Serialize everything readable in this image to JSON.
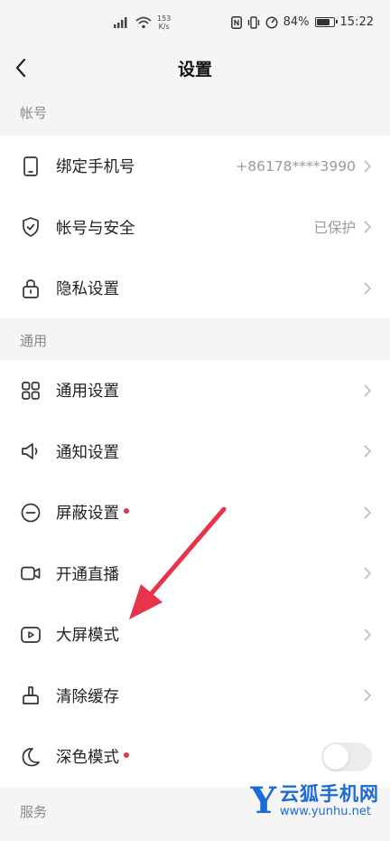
{
  "status_bar": {
    "net_speed_value": "153",
    "net_speed_unit": "K/s",
    "battery_percent": "84%",
    "battery_level": 0.84,
    "time": "15:22"
  },
  "nav": {
    "title": "设置"
  },
  "sections": {
    "account": {
      "header": "帐号"
    },
    "general": {
      "header": "通用"
    },
    "services": {
      "header": "服务"
    }
  },
  "rows": {
    "bind_phone": {
      "label": "绑定手机号",
      "value": "+86178****3990",
      "icon": "phone-icon"
    },
    "account_security": {
      "label": "帐号与安全",
      "value": "已保护",
      "icon": "shield-icon"
    },
    "privacy": {
      "label": "隐私设置",
      "icon": "lock-icon"
    },
    "general_settings": {
      "label": "通用设置",
      "icon": "grid-icon"
    },
    "notifications": {
      "label": "通知设置",
      "icon": "speaker-icon"
    },
    "block": {
      "label": "屏蔽设置",
      "icon": "block-icon",
      "badge": true
    },
    "live": {
      "label": "开通直播",
      "icon": "camera-icon"
    },
    "big_screen": {
      "label": "大屏模式",
      "icon": "play-screen-icon"
    },
    "clear_cache": {
      "label": "清除缓存",
      "icon": "broom-icon"
    },
    "dark_mode": {
      "label": "深色模式",
      "icon": "moon-icon",
      "badge": true,
      "toggle_on": false
    }
  },
  "colors": {
    "badge": "#e83250",
    "annotation_arrow": "#e8334a",
    "watermark": "#1c6ad6"
  },
  "watermark": {
    "logo_letter": "Y",
    "name": "云狐手机网",
    "url": "www.yunhu.net"
  }
}
